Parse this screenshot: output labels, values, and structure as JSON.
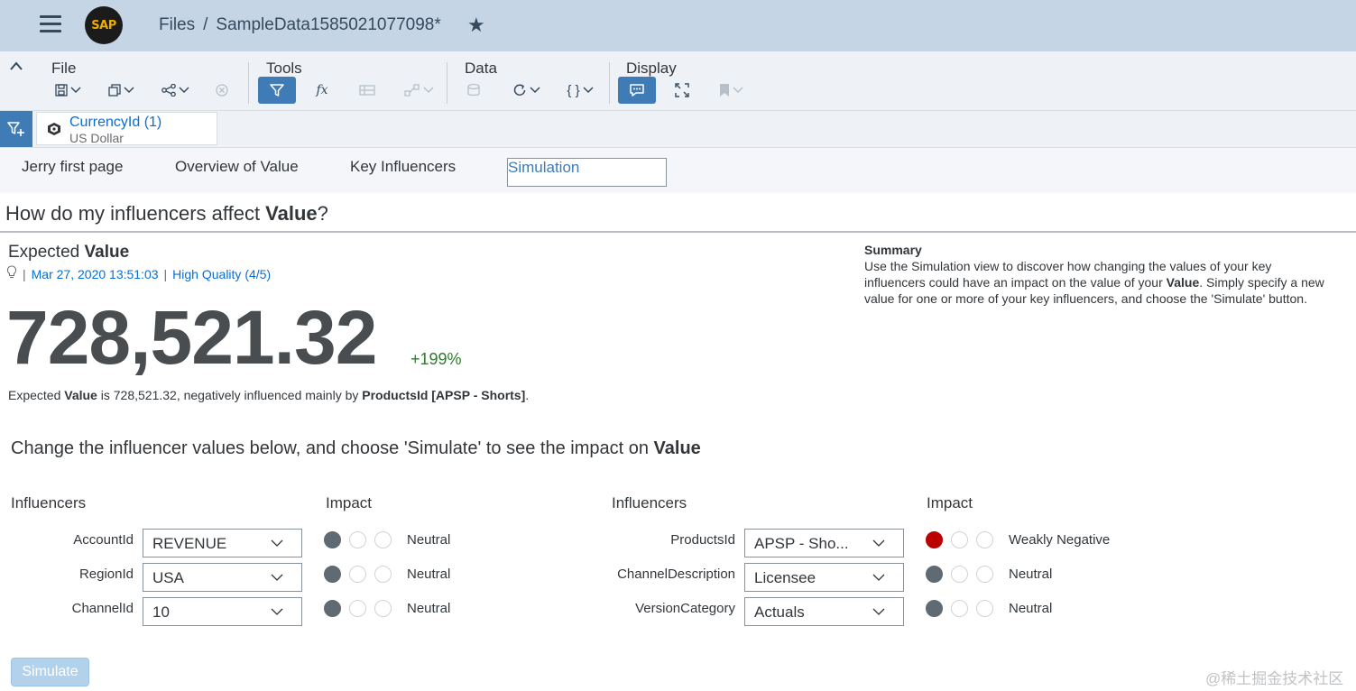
{
  "shell": {
    "logo_text": "SAP",
    "breadcrumb_root": "Files",
    "breadcrumb_sep": "/",
    "document_name": "SampleData1585021077098*"
  },
  "toolbar": {
    "groups": [
      "File",
      "Tools",
      "Data",
      "Display"
    ]
  },
  "filter": {
    "chip_title": "CurrencyId (1)",
    "chip_value": "US Dollar"
  },
  "tabs": [
    "Jerry first page",
    "Overview of Value",
    "Key Influencers",
    "Simulation"
  ],
  "page": {
    "title_prefix": "How do my influencers affect ",
    "title_bold": "Value",
    "title_suffix": "?"
  },
  "expected": {
    "label": "Expected ",
    "label_bold": "Value",
    "timestamp": "Mar 27, 2020 13:51:03",
    "quality": "High Quality (4/5)",
    "value": "728,521.32",
    "delta": "+199%",
    "explain_1": "Expected ",
    "explain_bold_1": "Value",
    "explain_2": " is 728,521.32, negatively influenced mainly by ",
    "explain_bold_2": "ProductsId [APSP - Shorts]",
    "explain_3": "."
  },
  "summary": {
    "heading": "Summary",
    "text_1": "Use the Simulation view to discover how changing the values of your key influencers could have an impact on the value of your ",
    "text_bold": "Value",
    "text_2": ". Simply specify a new value for one or more of your key influencers, and choose the 'Simulate' button."
  },
  "change": {
    "text": "Change the influencer values below, and choose 'Simulate' to see the impact on ",
    "bold": "Value"
  },
  "columns": {
    "influencers": "Influencers",
    "impact": "Impact"
  },
  "left_influencers": [
    {
      "name": "AccountId",
      "value": "REVENUE",
      "impact": "Neutral"
    },
    {
      "name": "RegionId",
      "value": "USA",
      "impact": "Neutral"
    },
    {
      "name": "ChannelId",
      "value": "10",
      "impact": "Neutral"
    }
  ],
  "right_influencers": [
    {
      "name": "ProductsId",
      "value": "APSP - Sho...",
      "impact": "Weakly Negative"
    },
    {
      "name": "ChannelDescription",
      "value": "Licensee",
      "impact": "Neutral"
    },
    {
      "name": "VersionCategory",
      "value": "Actuals",
      "impact": "Neutral"
    }
  ],
  "simulate_label": "Simulate",
  "watermark": "@稀土掘金技术社区",
  "colors": {
    "accent": "#3f7bb5",
    "link": "#0a6ed1",
    "positive": "#2b7d2b",
    "negative": "#bb0000",
    "neutral_dot": "#5f6a72"
  }
}
